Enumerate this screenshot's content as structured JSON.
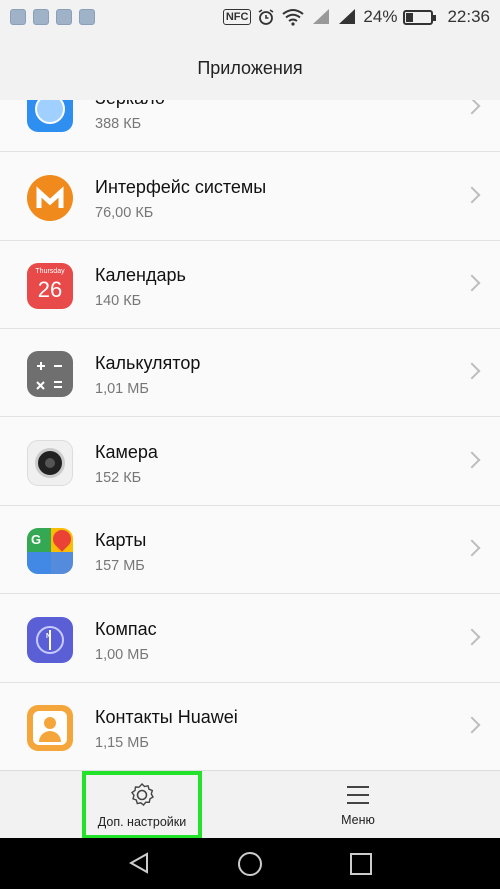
{
  "status_bar": {
    "battery_percent": "24%",
    "time": "22:36",
    "nfc_label": "NFC",
    "left_icons": [
      "health-icon",
      "gallery-icon",
      "bluetooth-icon",
      "wifi-notification-icon"
    ],
    "right_icons": [
      "nfc-icon",
      "alarm-icon",
      "wifi-icon",
      "signal-icon",
      "signal-icon",
      "battery-icon"
    ]
  },
  "header": {
    "title": "Приложения"
  },
  "apps": [
    {
      "name": "Зеркало",
      "size": "388 КБ",
      "icon": "mirror-app-icon",
      "color": "#2f8ff0"
    },
    {
      "name": "Интерфейс системы",
      "size": "76,00 КБ",
      "icon": "system-ui-app-icon",
      "color": "#f08a1c"
    },
    {
      "name": "Календарь",
      "size": "140 КБ",
      "icon": "calendar-app-icon",
      "color": "#e84a4a",
      "icon_label": "Thursday",
      "icon_day": "26"
    },
    {
      "name": "Калькулятор",
      "size": "1,01 МБ",
      "icon": "calculator-app-icon",
      "color": "#6f6f6f"
    },
    {
      "name": "Камера",
      "size": "152 КБ",
      "icon": "camera-app-icon",
      "color": "#f0f0f0"
    },
    {
      "name": "Карты",
      "size": "157 МБ",
      "icon": "maps-app-icon",
      "color": "#34a853"
    },
    {
      "name": "Компас",
      "size": "1,00 МБ",
      "icon": "compass-app-icon",
      "color": "#5a5fd6"
    },
    {
      "name": "Контакты Huawei",
      "size": "1,15 МБ",
      "icon": "contacts-app-icon",
      "color": "#f5a63a"
    }
  ],
  "bottom_bar": {
    "advanced_settings_label": "Доп. настройки",
    "menu_label": "Меню"
  },
  "colors": {
    "highlight": "#22e32a",
    "background": "#fafafa"
  }
}
